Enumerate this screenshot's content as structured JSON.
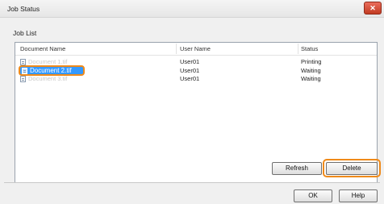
{
  "window": {
    "title": "Job Status",
    "close_symbol": "✕"
  },
  "job_list": {
    "group_label": "Job List",
    "columns": [
      "Document Name",
      "User Name",
      "Status"
    ],
    "rows": [
      {
        "document": "Document 1.tif",
        "user": "User01",
        "status": "Printing"
      },
      {
        "document": "Document 2.tif",
        "user": "User01",
        "status": "Waiting",
        "selected": true
      },
      {
        "document": "Document 3.tif",
        "user": "User01",
        "status": "Waiting"
      }
    ]
  },
  "buttons": {
    "refresh": "Refresh",
    "delete": "Delete",
    "ok": "OK",
    "help": "Help"
  },
  "colors": {
    "highlight": "#ef8a1a",
    "selection": "#3399ff"
  }
}
